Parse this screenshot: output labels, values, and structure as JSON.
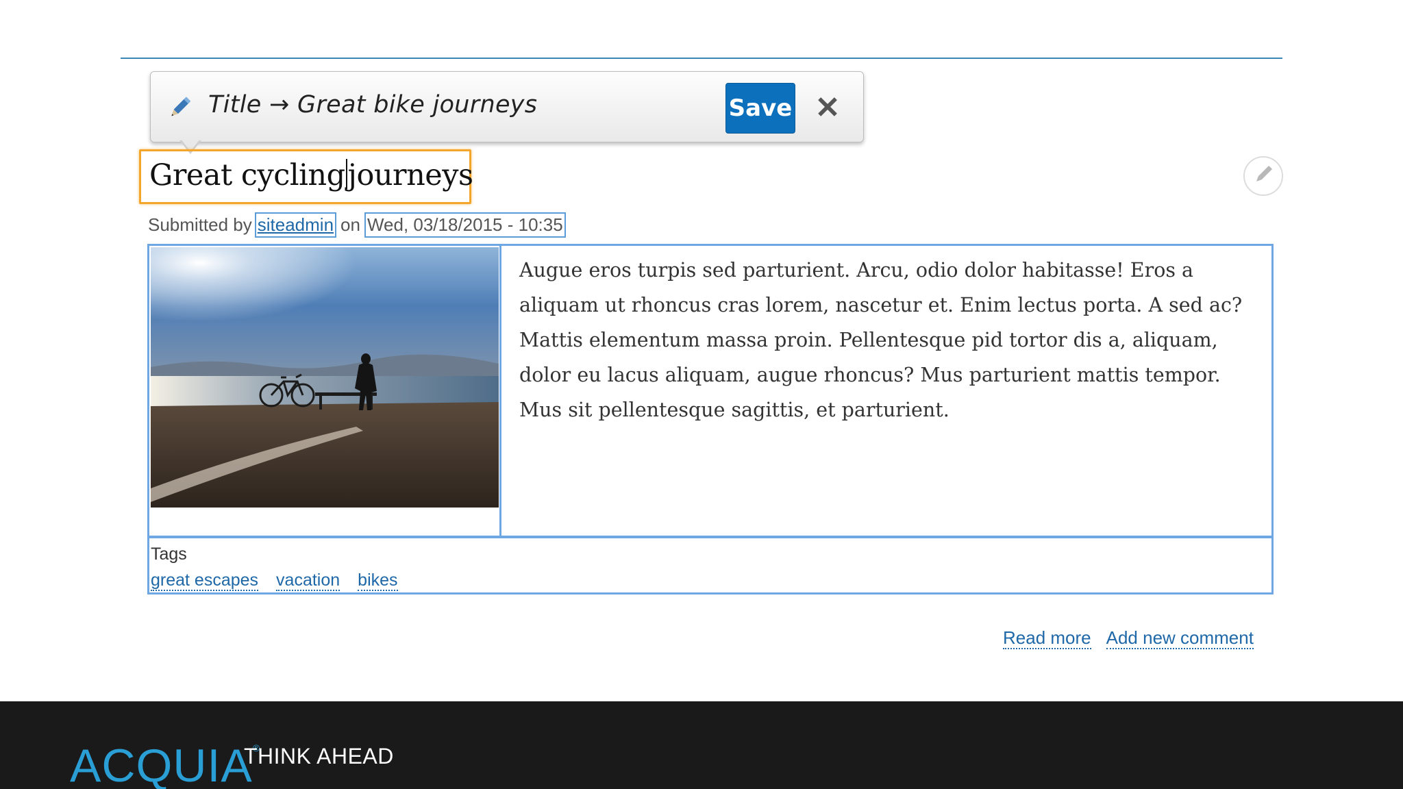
{
  "toolbar": {
    "field_label": "Title → Great bike journeys",
    "save_label": "Save",
    "close_glyph": "✕",
    "icon": "pencil-icon"
  },
  "node": {
    "title_before_caret": "Great cycling",
    "title_after_caret": "journeys",
    "submitted_prefix": "Submitted by",
    "author": "siteadmin",
    "on_word": "on",
    "date": "Wed, 03/18/2015 - 10:35",
    "body": "Augue eros turpis sed parturient. Arcu, odio dolor habitasse! Eros a aliquam ut rhoncus cras lorem, nascetur et. Enim lectus porta. A sed ac? Mattis elementum massa proin. Pellentesque pid tortor dis a, aliquam, dolor eu lacus aliquam, augue rhoncus? Mus parturient mattis tempor. Mus sit pellentesque sagittis, et parturient.",
    "tags_label": "Tags",
    "tags": [
      "great escapes",
      "vacation",
      "bikes"
    ],
    "links": {
      "read_more": "Read more",
      "add_comment": "Add new comment"
    }
  },
  "footer": {
    "brand": "ACQUIA",
    "tagline": "THINK AHEAD"
  },
  "colors": {
    "accent_blue": "#0d70bd",
    "focus_orange": "#f4a52c",
    "region_outline": "#6fa7e3",
    "link": "#1f68a8",
    "brand_blue": "#2a9fd6",
    "footer_bg": "#1a1a1a"
  }
}
